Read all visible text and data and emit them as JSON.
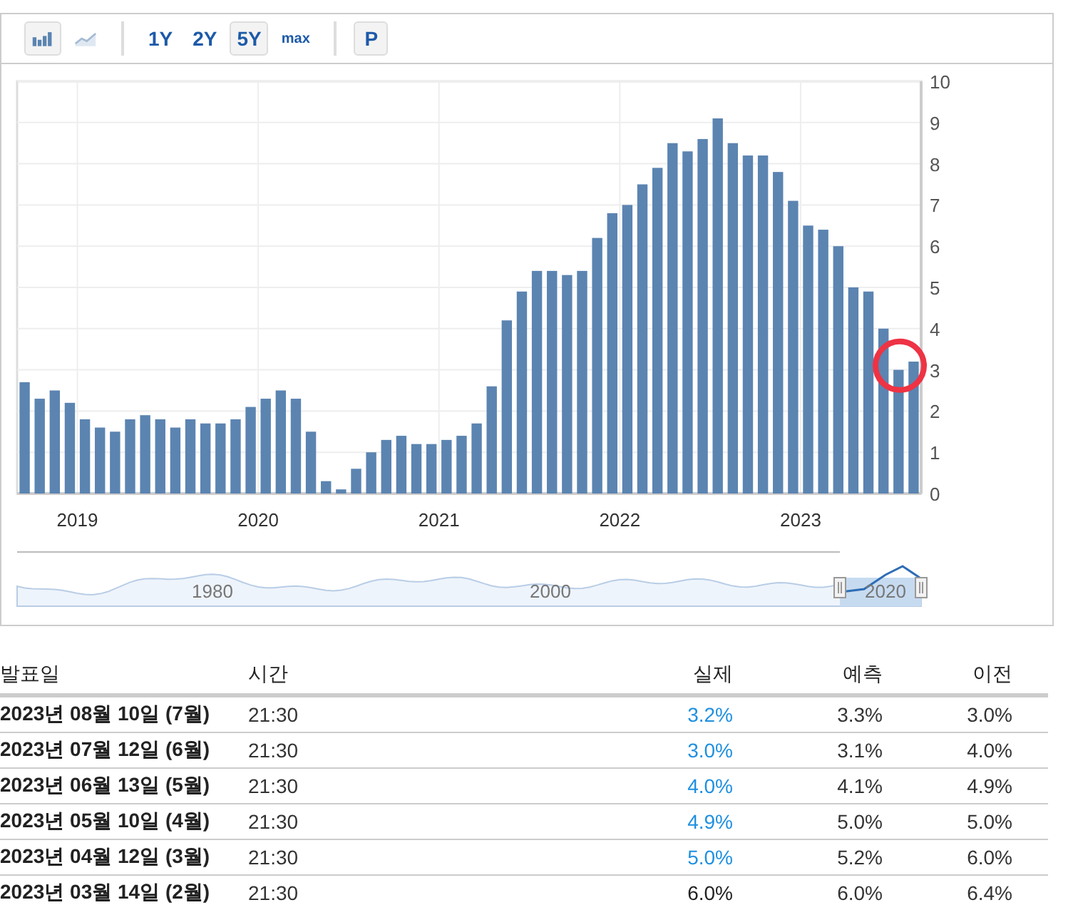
{
  "toolbar": {
    "chart_types": [
      {
        "kind": "bar",
        "selected": true
      },
      {
        "kind": "line",
        "selected": false
      }
    ],
    "ranges": [
      {
        "label": "1Y",
        "selected": false
      },
      {
        "label": "2Y",
        "selected": false
      },
      {
        "label": "5Y",
        "selected": true
      },
      {
        "label": "max",
        "selected": false
      }
    ],
    "print_button": "P"
  },
  "chart": {
    "x_axis_labels": [
      "2019",
      "2020",
      "2021",
      "2022",
      "2023"
    ],
    "chart_data": {
      "type": "bar",
      "ylim": [
        0,
        10
      ],
      "yticks": [
        0,
        1,
        2,
        3,
        4,
        5,
        6,
        7,
        8,
        9,
        10
      ],
      "grid": true,
      "series": [
        {
          "color": "#5b84b1",
          "values": [
            2.7,
            2.3,
            2.5,
            2.2,
            1.8,
            1.6,
            1.5,
            1.8,
            1.9,
            1.8,
            1.6,
            1.8,
            1.7,
            1.7,
            1.8,
            2.1,
            2.3,
            2.5,
            2.3,
            1.5,
            0.3,
            0.1,
            0.6,
            1.0,
            1.3,
            1.4,
            1.2,
            1.2,
            1.3,
            1.4,
            1.7,
            2.6,
            4.2,
            4.9,
            5.4,
            5.4,
            5.3,
            5.4,
            6.2,
            6.8,
            7.0,
            7.5,
            7.9,
            8.5,
            8.3,
            8.6,
            9.1,
            8.5,
            8.2,
            8.2,
            7.8,
            7.1,
            6.5,
            6.4,
            6.0,
            5.0,
            4.9,
            4.0,
            3.0,
            3.2
          ]
        }
      ]
    },
    "navigator": {
      "labels": [
        "1980",
        "2000",
        "2020"
      ]
    }
  },
  "table": {
    "columns": [
      "발표일",
      "시간",
      "실제",
      "예측",
      "이전"
    ],
    "rows": [
      {
        "date": "2023년 08월 10일 (7월)",
        "time": "21:30",
        "actual": "3.2%",
        "color": "#1e90e0",
        "forecast": "3.3%",
        "previous": "3.0%"
      },
      {
        "date": "2023년 07월 12일 (6월)",
        "time": "21:30",
        "actual": "3.0%",
        "color": "#1e90e0",
        "forecast": "3.1%",
        "previous": "4.0%"
      },
      {
        "date": "2023년 06월 13일 (5월)",
        "time": "21:30",
        "actual": "4.0%",
        "color": "#1e90e0",
        "forecast": "4.1%",
        "previous": "4.9%"
      },
      {
        "date": "2023년 05월 10일 (4월)",
        "time": "21:30",
        "actual": "4.9%",
        "color": "#1e90e0",
        "forecast": "5.0%",
        "previous": "5.0%"
      },
      {
        "date": "2023년 04월 12일 (3월)",
        "time": "21:30",
        "actual": "5.0%",
        "color": "#1e90e0",
        "forecast": "5.2%",
        "previous": "6.0%"
      },
      {
        "date": "2023년 03월 14일 (2월)",
        "time": "21:30",
        "actual": "6.0%",
        "color": "#222222",
        "forecast": "6.0%",
        "previous": "6.4%"
      }
    ]
  }
}
